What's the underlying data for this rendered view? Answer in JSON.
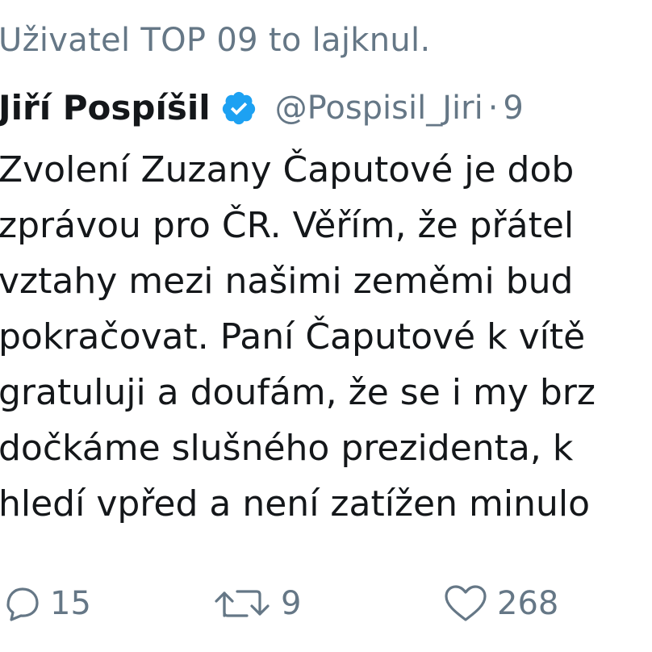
{
  "context": {
    "text": "Uživatel TOP 09 to lajknul."
  },
  "tweet": {
    "author_name": "Jiří Pospíšil",
    "handle": "@Pospisil_Jiri",
    "separator": "·",
    "time": "9",
    "verified": true,
    "verified_color": "#1da1f2",
    "text_lines": [
      "Zvolení Zuzany Čaputové je dob",
      "zprávou pro ČR. Věřím, že přátel",
      "vztahy mezi našimi zeměmi bud",
      "pokračovat. Paní Čaputové k vítě",
      "gratuluji a doufám, že se i my brz",
      "dočkáme slušného prezidenta, k",
      "hledí vpřed a není zatížen minulo"
    ]
  },
  "actions": {
    "reply": {
      "icon": "reply-icon",
      "count": "15"
    },
    "retweet": {
      "icon": "retweet-icon",
      "count": "9"
    },
    "like": {
      "icon": "heart-icon",
      "count": "268"
    }
  },
  "colors": {
    "text": "#14171a",
    "secondary": "#657786",
    "verified": "#1da1f2"
  }
}
